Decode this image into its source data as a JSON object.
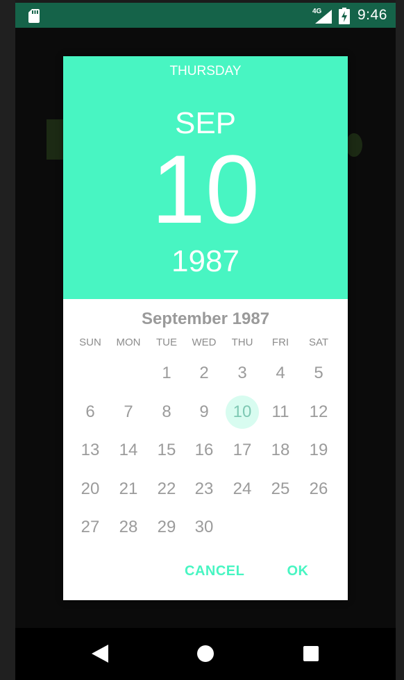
{
  "status_bar": {
    "network_type": "4G",
    "time": "9:46",
    "icons": [
      "sd-card-icon",
      "signal-icon",
      "battery-charging-icon"
    ]
  },
  "date_picker": {
    "header": {
      "day_of_week": "THURSDAY",
      "month": "SEP",
      "day": "10",
      "year": "1987",
      "background_color": "#48f5c2"
    },
    "month_title": "September 1987",
    "weekdays": [
      "SUN",
      "MON",
      "TUE",
      "WED",
      "THU",
      "FRI",
      "SAT"
    ],
    "first_weekday_index": 2,
    "days": [
      "1",
      "2",
      "3",
      "4",
      "5",
      "6",
      "7",
      "8",
      "9",
      "10",
      "11",
      "12",
      "13",
      "14",
      "15",
      "16",
      "17",
      "18",
      "19",
      "20",
      "21",
      "22",
      "23",
      "24",
      "25",
      "26",
      "27",
      "28",
      "29",
      "30"
    ],
    "selected_day": "10",
    "selected_color": "#d8fcf0",
    "buttons": {
      "cancel": "CANCEL",
      "ok": "OK"
    },
    "accent_color": "#48f5c2"
  },
  "nav_bar": {
    "icons": [
      "back-icon",
      "home-icon",
      "recents-icon"
    ]
  }
}
